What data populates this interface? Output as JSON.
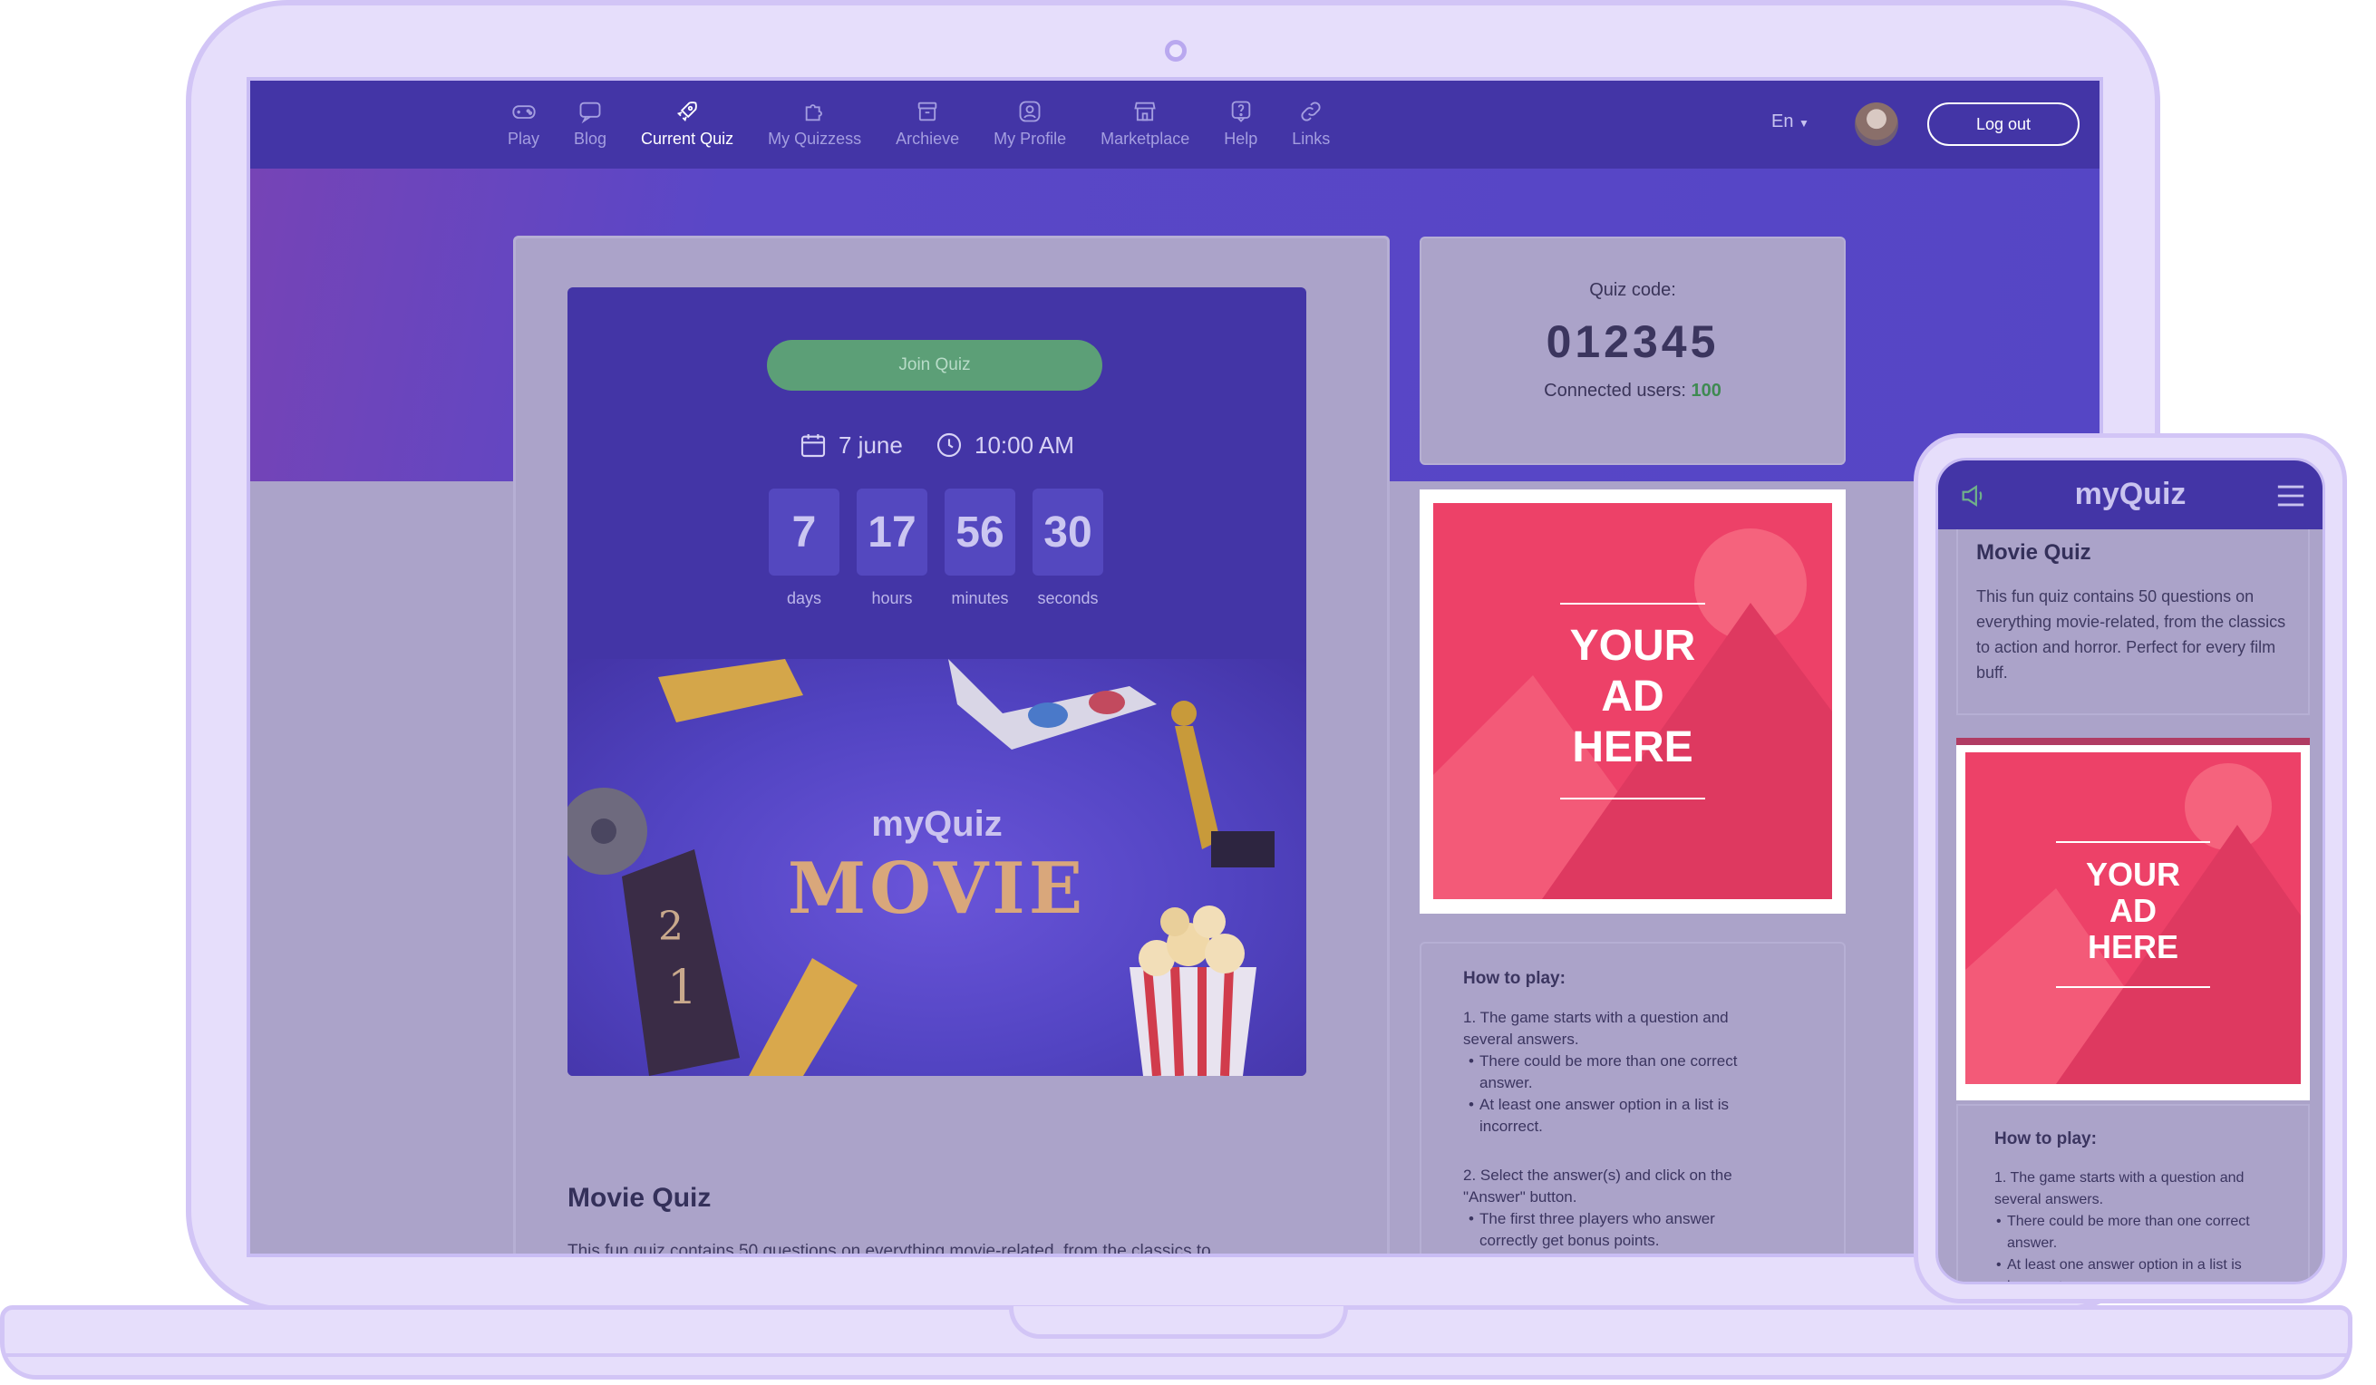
{
  "nav": {
    "items": [
      {
        "label": "Play",
        "icon": "gamepad-icon"
      },
      {
        "label": "Blog",
        "icon": "chat-icon"
      },
      {
        "label": "Current Quiz",
        "icon": "rocket-icon",
        "active": true
      },
      {
        "label": "My Quizzess",
        "icon": "puzzle-icon"
      },
      {
        "label": "Archieve",
        "icon": "archive-icon"
      },
      {
        "label": "My Profile",
        "icon": "profile-icon"
      },
      {
        "label": "Marketplace",
        "icon": "store-icon"
      },
      {
        "label": "Help",
        "icon": "help-icon"
      },
      {
        "label": "Links",
        "icon": "link-icon"
      }
    ],
    "language": "En",
    "logout": "Log out"
  },
  "quiz": {
    "join_label": "Join Quiz",
    "date": "7 june",
    "time": "10:00 AM",
    "countdown": [
      {
        "value": "7",
        "label": "days"
      },
      {
        "value": "17",
        "label": "hours"
      },
      {
        "value": "56",
        "label": "minutes"
      },
      {
        "value": "30",
        "label": "seconds"
      }
    ],
    "art_logo": "myQuiz",
    "art_title": "MOVIE",
    "title": "Movie Quiz",
    "description": "This fun quiz contains 50 questions on everything movie-related, from the classics to action and horror. Perfect for every film buff."
  },
  "code_card": {
    "label": "Quiz code:",
    "code": "012345",
    "users_label": "Connected users:",
    "users_count": "100"
  },
  "ad": {
    "line1": "YOUR",
    "line2": "AD",
    "line3": "HERE"
  },
  "howto": {
    "title": "How to play:",
    "step1": "1. The game starts with a question and several answers.",
    "step1_b1": "There could be more than one correct answer.",
    "step1_b2": "At least one answer option in a list is incorrect.",
    "step2": "2. Select the answer(s) and click on the \"Answer\" button.",
    "step2_b1": "The first three players who answer correctly get bonus points."
  },
  "mobile": {
    "logo": "myQuiz",
    "title": "Movie Quiz",
    "description": "This fun quiz contains 50 questions on everything movie-related, from the classics to action and horror. Perfect for every film buff.",
    "howto_title": "How to play:",
    "howto_step1": "1. The game starts with a question and several answers.",
    "howto_b1": "There could be more than one correct answer.",
    "howto_b2": "At least one answer option in a list is incorrect."
  },
  "colors": {
    "nav_bg": "#4335a6",
    "accent_green": "#5c9f77",
    "ad_pink": "#ed4168",
    "overlay": "#aba3c9"
  }
}
